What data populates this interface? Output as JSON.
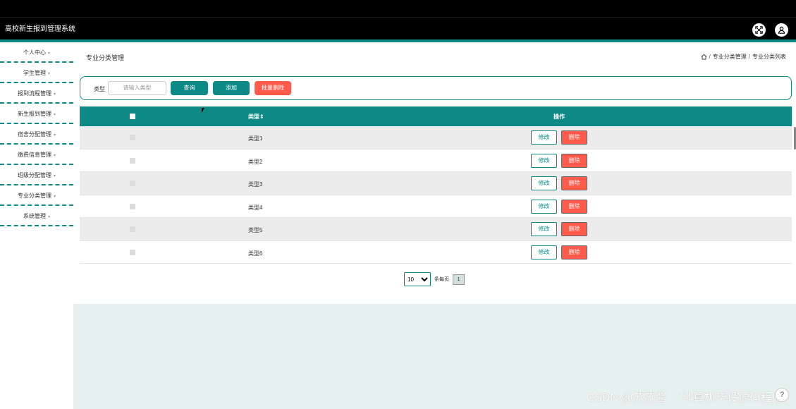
{
  "app": {
    "title": "高校新生报到管理系统"
  },
  "header": {
    "fullscreen_icon": "expand-icon",
    "user_icon": "user-icon"
  },
  "sidebar": {
    "items": [
      {
        "label": "个人中心"
      },
      {
        "label": "学生管理"
      },
      {
        "label": "报到流程管理"
      },
      {
        "label": "新生报到管理"
      },
      {
        "label": "宿舍分配管理"
      },
      {
        "label": "缴费信息管理"
      },
      {
        "label": "班级分配管理"
      },
      {
        "label": "专业分类管理"
      },
      {
        "label": "系统管理"
      }
    ],
    "caret": "▾"
  },
  "page": {
    "title": "专业分类管理",
    "breadcrumb": {
      "home_icon": "home-icon",
      "sep": "/",
      "level1": "专业分类管理",
      "level2": "专业分类列表"
    }
  },
  "filter": {
    "label": "类型",
    "placeholder": "请输入类型",
    "query_button": "查询",
    "add_button": "添加",
    "batch_delete_button": "批量删除"
  },
  "table": {
    "headers": {
      "type": "类型⇕",
      "actions": "操作"
    },
    "rows": [
      {
        "type": "类型1"
      },
      {
        "type": "类型2"
      },
      {
        "type": "类型3"
      },
      {
        "type": "类型4"
      },
      {
        "type": "类型5"
      },
      {
        "type": "类型6"
      }
    ],
    "edit_label": "修改",
    "delete_label": "删除"
  },
  "pagination": {
    "page_size": "10",
    "per_page_label": "条每页",
    "current_page": "1"
  },
  "watermark": "CSDN @苏苏酱　`计算机毕设源码程序",
  "help_label": "?",
  "colors": {
    "accent": "#0d8a86",
    "danger": "#ff5a4a",
    "header": "#000000"
  }
}
